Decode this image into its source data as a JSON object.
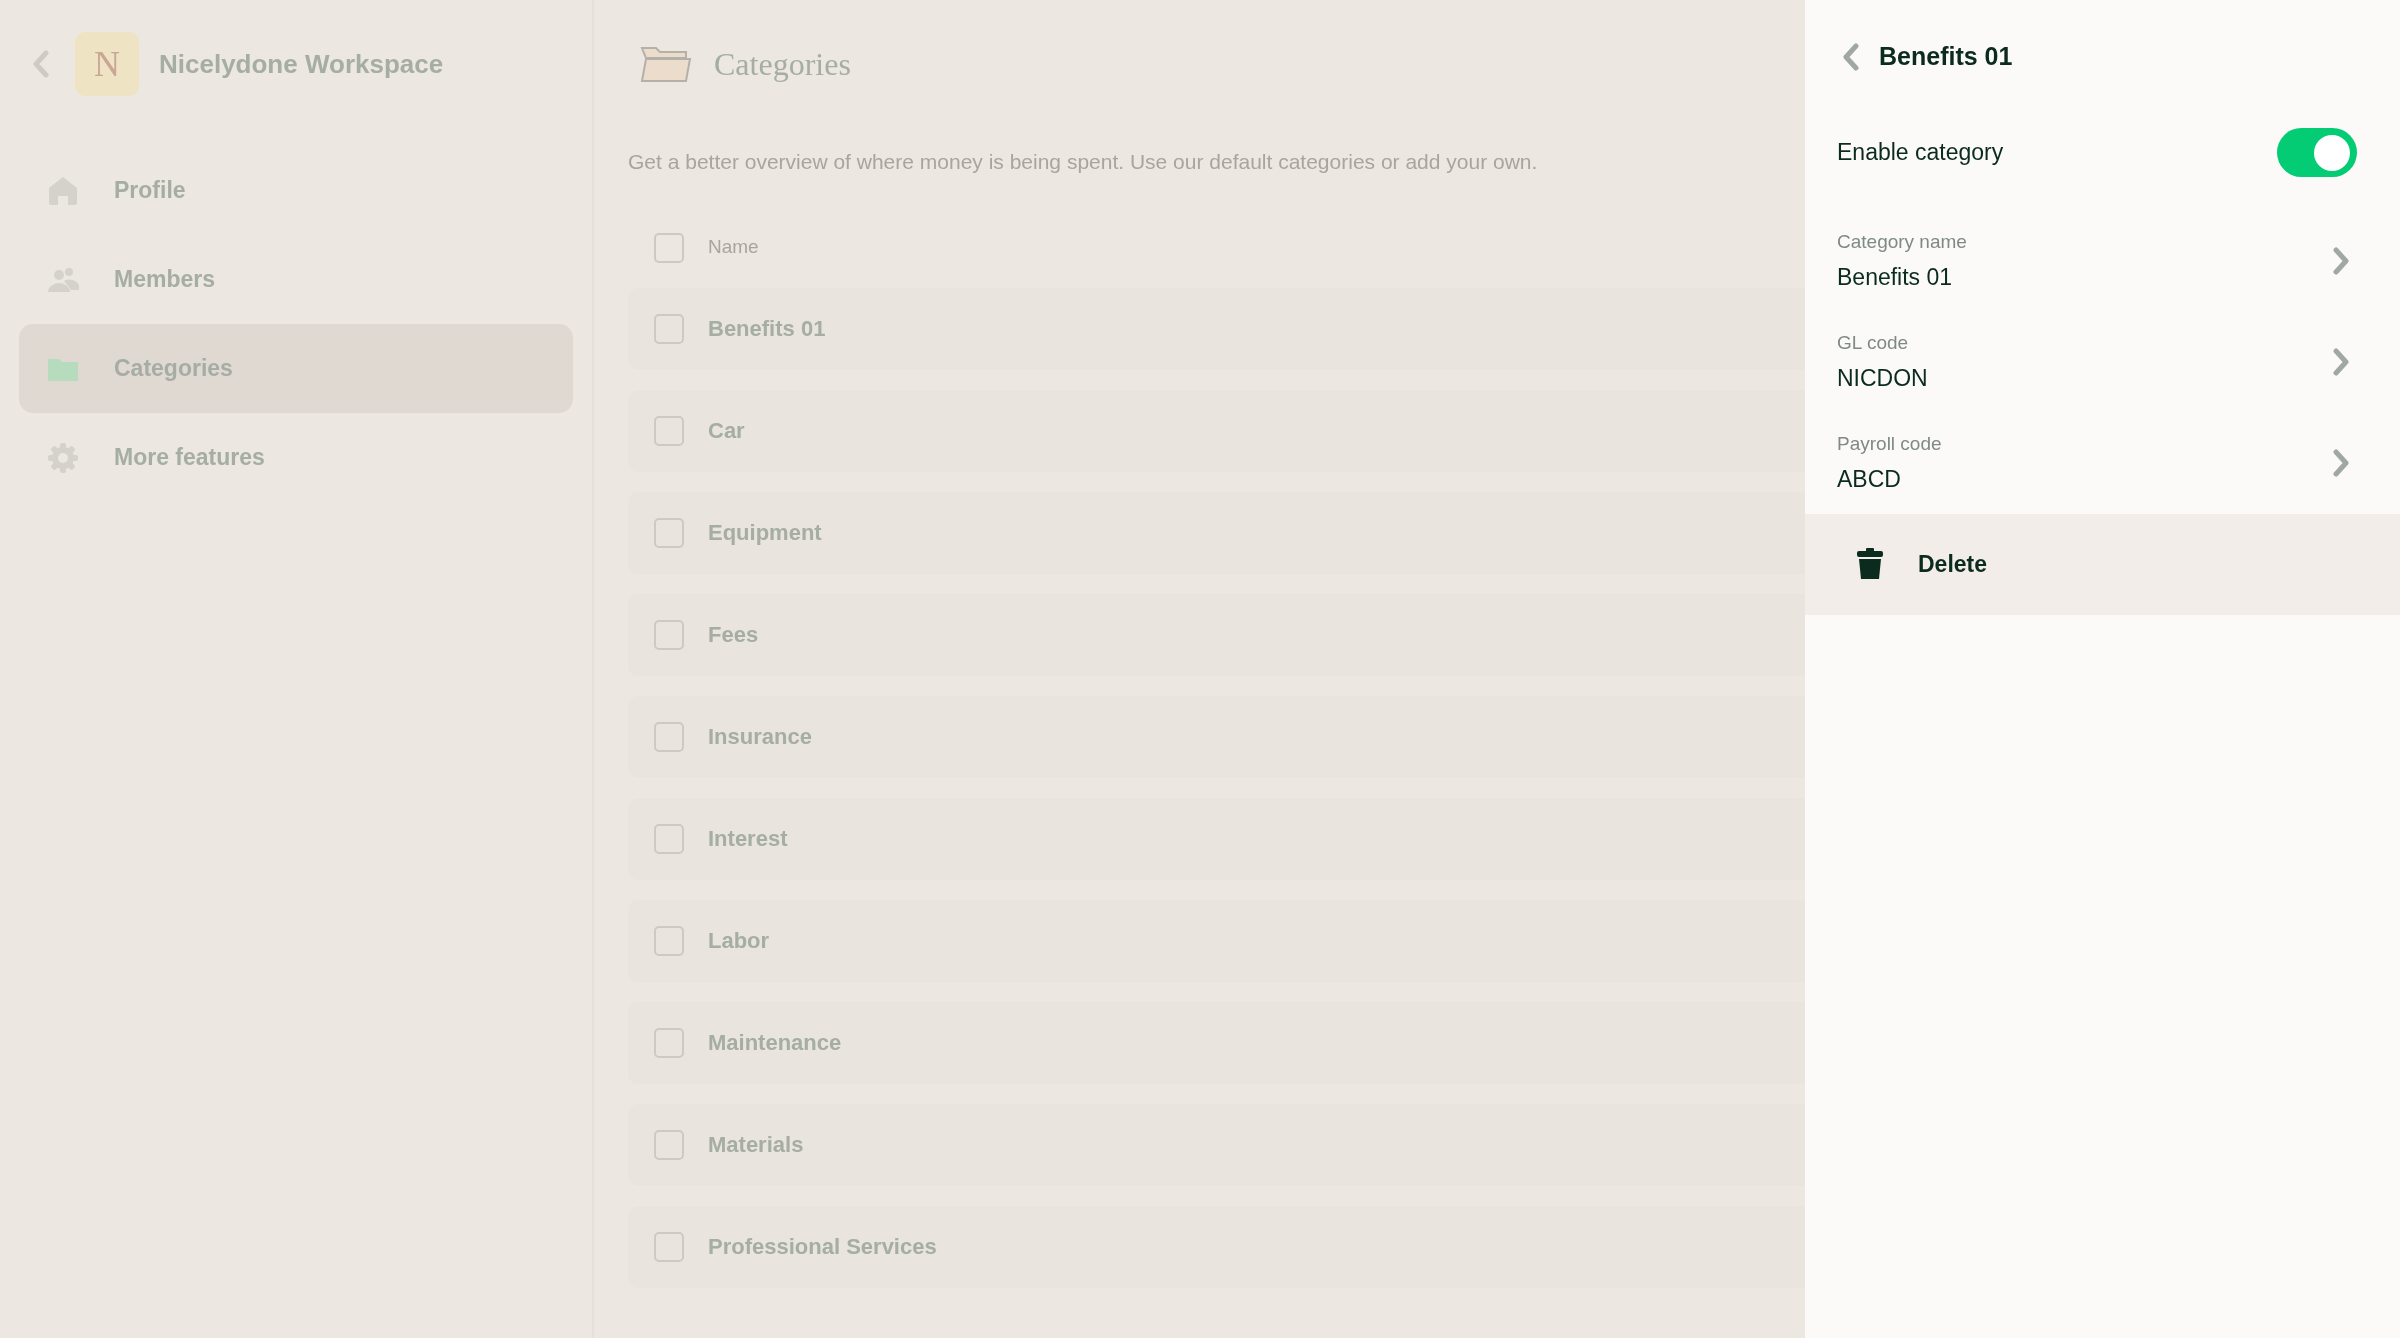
{
  "sidebar": {
    "workspace": {
      "initial": "N",
      "name": "Nicelydone Workspace"
    },
    "items": [
      {
        "label": "Profile",
        "kind": "home",
        "selected": false
      },
      {
        "label": "Members",
        "kind": "people",
        "selected": false
      },
      {
        "label": "Categories",
        "kind": "folder",
        "selected": true
      },
      {
        "label": "More features",
        "kind": "gear",
        "selected": false
      }
    ]
  },
  "page": {
    "title": "Categories",
    "description": "Get a better overview of where money is being spent. Use our default categories or add your own.",
    "table": {
      "columns": [
        "Name"
      ],
      "header_checked": false,
      "rows": [
        {
          "name": "Benefits 01",
          "checked": false
        },
        {
          "name": "Car",
          "checked": false
        },
        {
          "name": "Equipment",
          "checked": false
        },
        {
          "name": "Fees",
          "checked": false
        },
        {
          "name": "Insurance",
          "checked": false
        },
        {
          "name": "Interest",
          "checked": false
        },
        {
          "name": "Labor",
          "checked": false
        },
        {
          "name": "Maintenance",
          "checked": false
        },
        {
          "name": "Materials",
          "checked": false
        },
        {
          "name": "Professional Services",
          "checked": false
        }
      ]
    }
  },
  "panel": {
    "title": "Benefits 01",
    "toggle": {
      "label": "Enable category",
      "on": true
    },
    "fields": [
      {
        "label": "Category name",
        "value": "Benefits 01"
      },
      {
        "label": "GL code",
        "value": "NICDON"
      },
      {
        "label": "Payroll code",
        "value": "ABCD"
      }
    ],
    "delete": {
      "label": "Delete"
    }
  }
}
